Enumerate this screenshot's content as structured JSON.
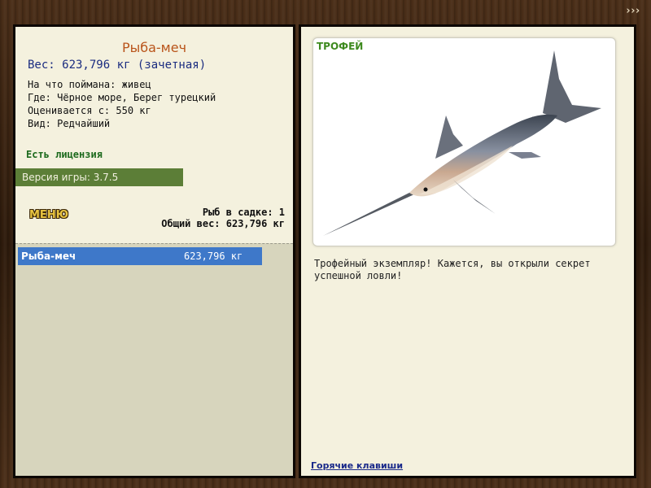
{
  "nav": {
    "arrows": "›››"
  },
  "fish": {
    "name": "Рыба-меч",
    "weight_line": "Вес: 623,796 кг (зачетная)",
    "bait_line": "На что поймана: живец",
    "location_line": "Где: Чёрное море, Берег турецкий",
    "valued_line": "Оценивается с: 550 кг",
    "kind_line": "Вид: Редчайший"
  },
  "license": "Есть лицензия",
  "version": "Версия игры: 3.7.5",
  "menu_label": "МЕНЮ",
  "stats": {
    "count_line": "Рыб в садке: 1",
    "total_line": "Общий вес: 623,796 кг"
  },
  "catch_list": [
    {
      "name": "Рыба-меч",
      "weight": "623,796 кг"
    }
  ],
  "trophy": {
    "label": "ТРОФЕЙ",
    "description": "Трофейный экземпляр! Кажется, вы открыли секрет успешной ловли!"
  },
  "hotkeys_label": "Горячие клавиши",
  "colors": {
    "accent_name": "#b9541a",
    "weight_text": "#1a2c80",
    "license_text": "#1d6a1d",
    "version_bar": "#5c7e37",
    "selected_row": "#3e78c9",
    "trophy_label": "#3e8a1f"
  }
}
